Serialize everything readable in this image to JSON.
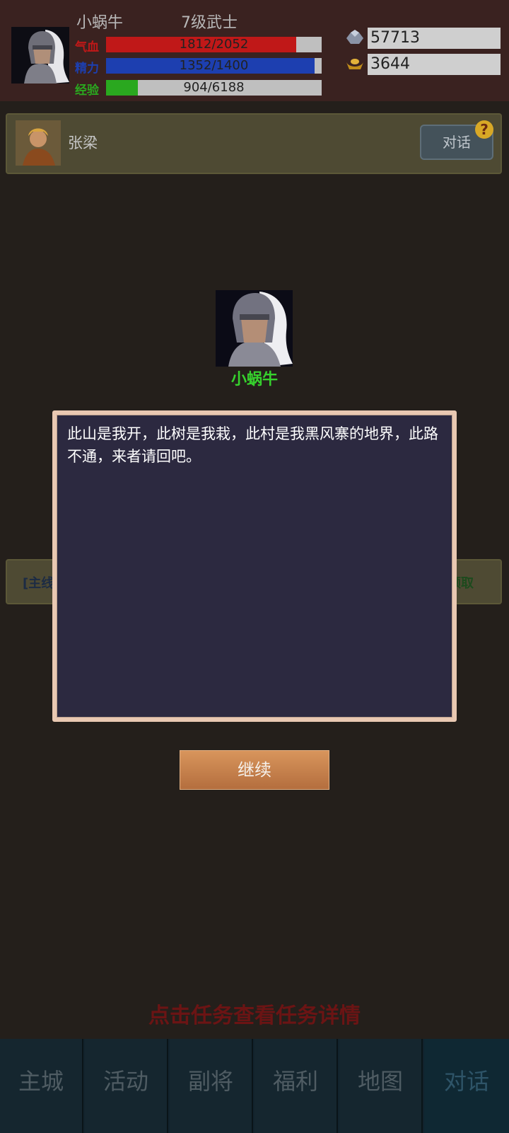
{
  "player": {
    "name": "小蜗牛",
    "level_text": "7级武士",
    "hp": {
      "label": "气血",
      "text": "1812/2052",
      "fraction": 0.883,
      "color": "#c01818"
    },
    "mp": {
      "label": "精力",
      "text": "1352/1400",
      "fraction": 0.966,
      "color": "#1d3fb0"
    },
    "xp": {
      "label": "经验",
      "text": "904/6188",
      "fraction": 0.146,
      "color": "#2aa81f"
    }
  },
  "resources": {
    "silver": {
      "icon": "silver-ingot-icon",
      "value": "57713"
    },
    "gold": {
      "icon": "gold-ingot-icon",
      "value": "3644"
    }
  },
  "npc": {
    "name": "张梁",
    "talk_label": "对话",
    "badge": "?"
  },
  "task": {
    "left_fragment": "[主线",
    "right_fragment": "领取"
  },
  "dialog": {
    "speaker": "小蜗牛",
    "text": "此山是我开，此树是我栽，此村是我黑风寨的地界，此路不通，来者请回吧。",
    "continue_label": "继续"
  },
  "hint": "点击任务查看任务详情",
  "nav": [
    {
      "label": "主城"
    },
    {
      "label": "活动"
    },
    {
      "label": "副将"
    },
    {
      "label": "福利"
    },
    {
      "label": "地图"
    },
    {
      "label": "对话"
    }
  ]
}
